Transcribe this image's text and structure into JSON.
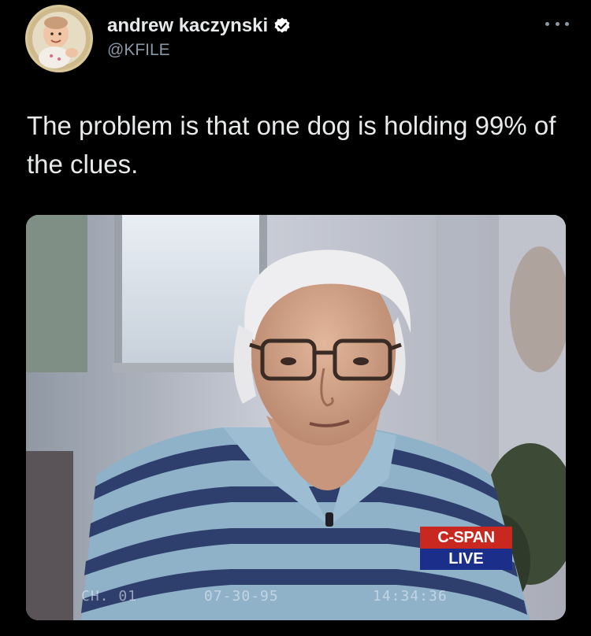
{
  "author": {
    "display_name": "andrew kaczynski",
    "handle": "@KFILE",
    "verified_icon": "verified-badge-icon",
    "avatar_icon": "avatar-baby-photo"
  },
  "menu": {
    "icon": "more-options-icon"
  },
  "tweet": {
    "text": "The problem is that one dog is holding 99% of the clues."
  },
  "media": {
    "description_icon": "video-still-photo",
    "network_overlay": {
      "network": "C-SPAN",
      "status": "LIVE"
    },
    "timestamp": {
      "channel": "CH. 01",
      "date": "07-30-95",
      "time": "14:34:36"
    }
  },
  "colors": {
    "background": "#000000",
    "text_primary": "#e7e9ea",
    "text_secondary": "#8b98a5",
    "cspan_red": "#c8281f",
    "cspan_blue": "#1b2f8a"
  }
}
